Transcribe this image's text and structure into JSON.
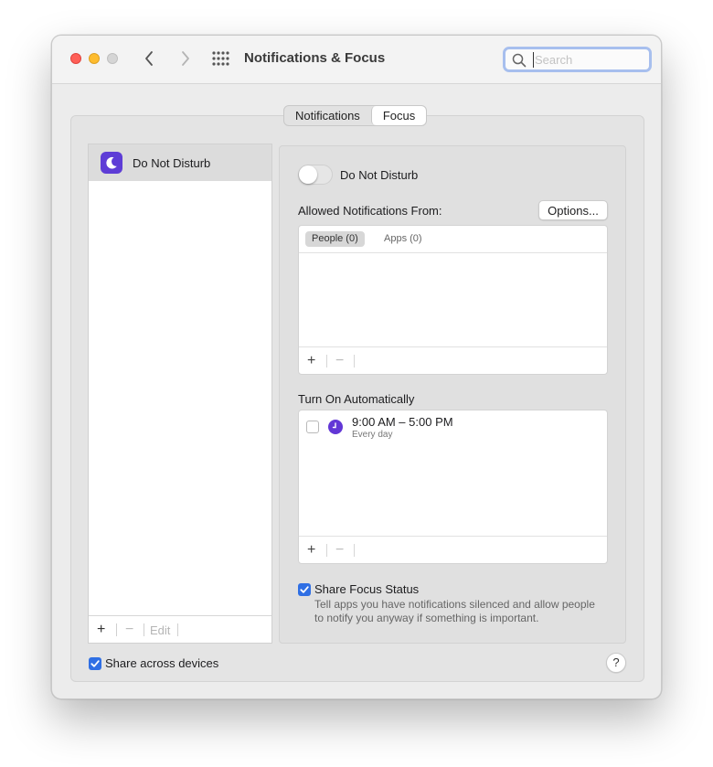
{
  "window": {
    "title": "Notifications & Focus",
    "search_placeholder": "Search",
    "search_value": ""
  },
  "icons": {
    "back": "chevron-left-icon",
    "forward": "chevron-right-icon",
    "grid": "grid-icon",
    "search": "search-icon",
    "moon": "moon-icon",
    "clock": "clock-icon",
    "check": "checkmark-icon"
  },
  "tabs": [
    {
      "label": "Notifications",
      "active": false
    },
    {
      "label": "Focus",
      "active": true
    }
  ],
  "focus_list": {
    "items": [
      {
        "label": "Do Not Disturb",
        "selected": true
      }
    ],
    "footer": {
      "add": "+",
      "remove": "−",
      "edit": "Edit"
    }
  },
  "detail": {
    "toggle_label": "Do Not Disturb",
    "toggle_on": false,
    "allowed_label": "Allowed Notifications From:",
    "options_label": "Options...",
    "allowed_tabs": [
      {
        "label": "People (0)",
        "active": true
      },
      {
        "label": "Apps (0)",
        "active": false
      }
    ],
    "allowed_footer": {
      "add": "+",
      "remove": "−"
    },
    "auto_label": "Turn On Automatically",
    "schedule": [
      {
        "time": "9:00 AM – 5:00 PM",
        "subtitle": "Every day",
        "checked": false
      }
    ],
    "auto_footer": {
      "add": "+",
      "remove": "−"
    },
    "share_focus_label": "Share Focus Status",
    "share_focus_checked": true,
    "share_focus_desc": "Tell apps you have notifications silenced and allow people to notify you anyway if something is important."
  },
  "share_across_devices_label": "Share across devices",
  "share_across_devices_checked": true,
  "help_label": "?",
  "colors": {
    "accent": "#2f6fe4",
    "focus_purple": "#5e3dd6",
    "close": "#ff5f57",
    "minimize": "#febc2e"
  }
}
